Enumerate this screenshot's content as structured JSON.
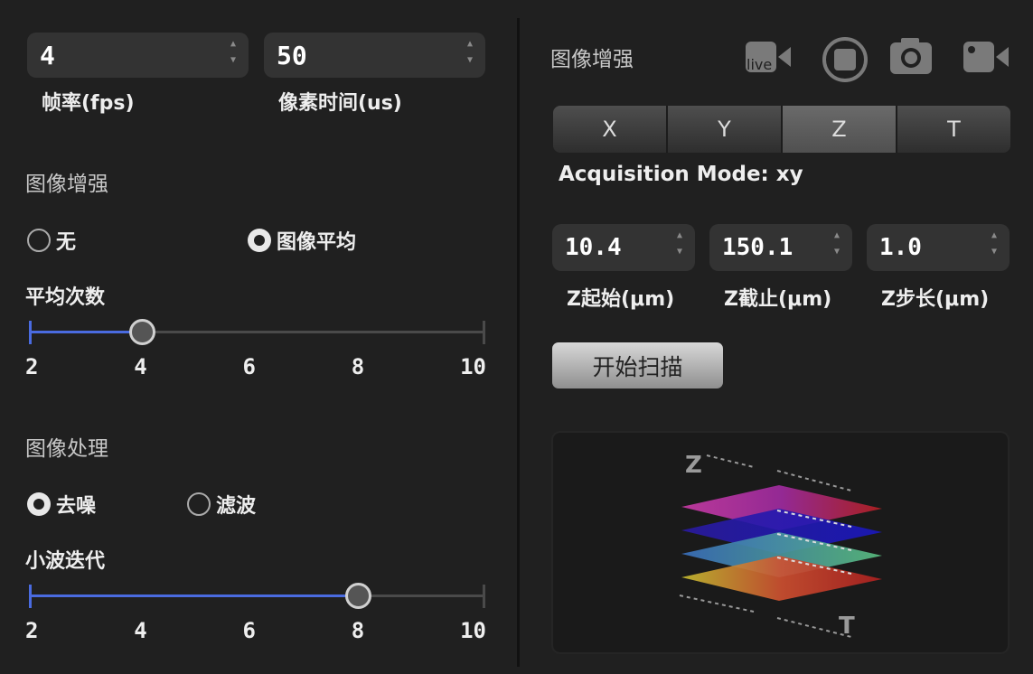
{
  "left": {
    "frame_rate": {
      "value": "4",
      "label": "帧率(fps)"
    },
    "pixel_time": {
      "value": "50",
      "label": "像素时间(us)"
    },
    "enhance": {
      "title": "图像增强",
      "opt_none": "无",
      "opt_avg": "图像平均",
      "selected": "图像平均",
      "avg_count_label": "平均次数",
      "slider": {
        "min": 2,
        "max": 10,
        "value": 4,
        "ticks": [
          "2",
          "4",
          "6",
          "8",
          "10"
        ]
      }
    },
    "process": {
      "title": "图像处理",
      "opt_denoise": "去噪",
      "opt_filter": "滤波",
      "selected": "去噪",
      "wavelet_label": "小波迭代",
      "slider": {
        "min": 2,
        "max": 10,
        "value": 8,
        "ticks": [
          "2",
          "4",
          "6",
          "8",
          "10"
        ]
      }
    }
  },
  "right": {
    "title": "图像增强",
    "icons": [
      "live-camera-icon",
      "stop-icon",
      "camera-icon",
      "video-camera-icon"
    ],
    "live_text": "live",
    "tabs": [
      "X",
      "Y",
      "Z",
      "T"
    ],
    "active_tab": "Z",
    "acq_mode": "Acquisition Mode: xy",
    "z_start": {
      "value": "10.4",
      "label": "Z起始(μm)"
    },
    "z_end": {
      "value": "150.1",
      "label": "Z截止(μm)"
    },
    "z_step": {
      "value": "1.0",
      "label": "Z步长(μm)"
    },
    "scan_button": "开始扫描",
    "diagram": {
      "z_label": "Z",
      "t_label": "T"
    }
  },
  "colors": {
    "accent": "#4a6be0",
    "bg": "#202020",
    "panel": "#333333"
  }
}
